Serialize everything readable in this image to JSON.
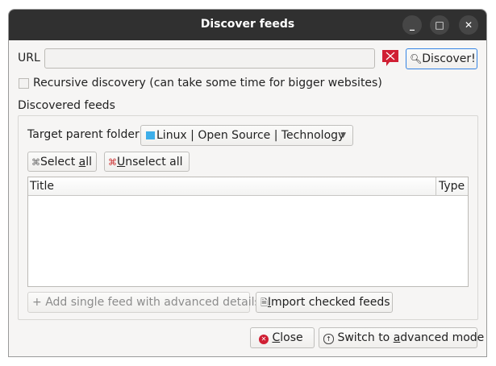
{
  "window": {
    "title": "Discover feeds",
    "minimize_label": "_",
    "maximize_label": "□",
    "close_label": "✕"
  },
  "url": {
    "label": "URL",
    "value": "",
    "placeholder": "",
    "status_icon": "error-flag-icon",
    "discover_label": "Discover!"
  },
  "recursive": {
    "label": "Recursive discovery (can take some time for bigger websites)",
    "checked": false
  },
  "discovered": {
    "group_label": "Discovered feeds",
    "target_label": "Target parent folder",
    "target_value": "Linux | Open Source | Technology",
    "select_all": {
      "pre": "Select ",
      "u": "a",
      "post": "ll"
    },
    "unselect_all": {
      "pre": "",
      "u": "U",
      "post": "nselect all"
    },
    "columns": [
      "Title",
      "Type"
    ],
    "rows": [],
    "add_single_label": "Add single feed with advanced details",
    "import": {
      "pre": "",
      "u": "I",
      "post": "mport checked feeds"
    }
  },
  "footer": {
    "close": {
      "pre": "",
      "u": "C",
      "post": "lose"
    },
    "advanced": {
      "pre": "Switch to ",
      "u": "a",
      "post": "dvanced mode"
    }
  },
  "colors": {
    "accent": "#3584e4",
    "error": "#d01f33",
    "folder": "#3daee9"
  }
}
